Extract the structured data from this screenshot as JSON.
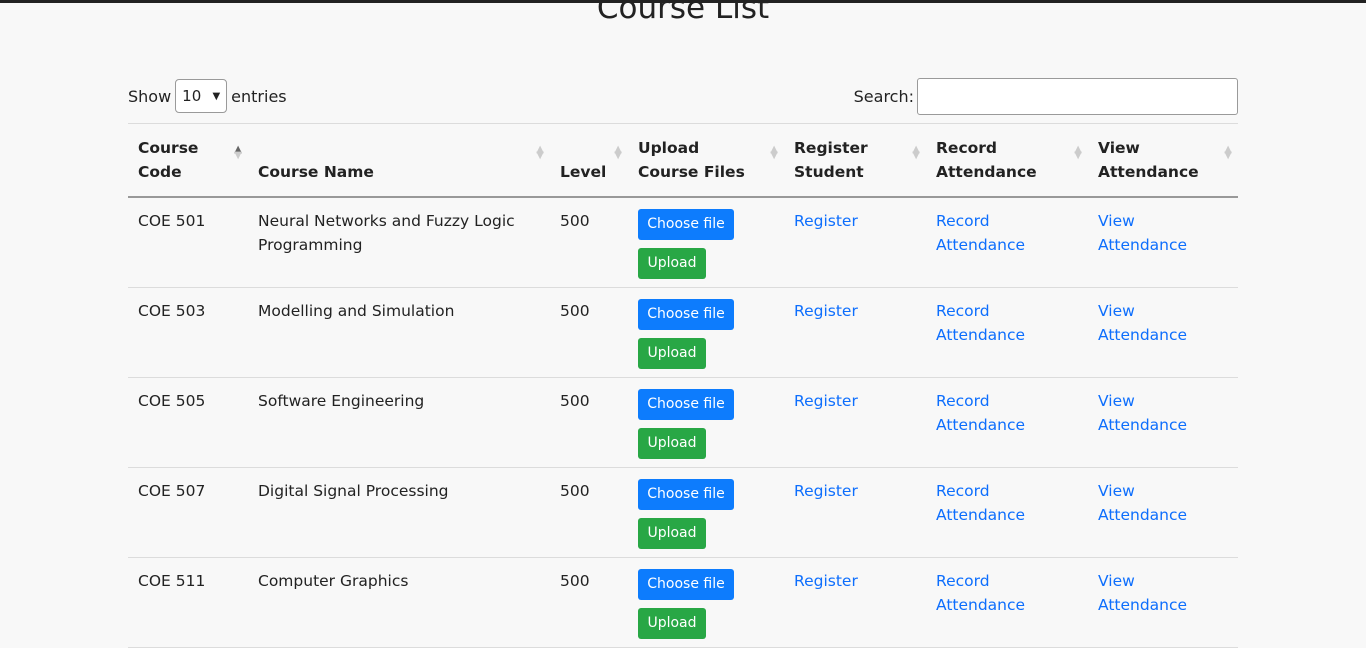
{
  "page": {
    "title": "Course List"
  },
  "controls": {
    "show_label": "Show",
    "entries_value": "10",
    "entries_label": "entries",
    "search_label": "Search:",
    "search_value": ""
  },
  "table": {
    "headers": [
      {
        "line1": "Course",
        "line2": "Code"
      },
      {
        "line1": "",
        "line2": "Course Name"
      },
      {
        "line1": "",
        "line2": "Level"
      },
      {
        "line1": "Upload",
        "line2": "Course Files"
      },
      {
        "line1": "Register",
        "line2": "Student"
      },
      {
        "line1": "Record",
        "line2": "Attendance"
      },
      {
        "line1": "View",
        "line2": "Attendance"
      }
    ],
    "sorted_column": "Course Code",
    "sort_direction": "ascending",
    "rows": [
      {
        "code": "COE 501",
        "name": "Neural Networks and Fuzzy Logic Programming",
        "level": "500",
        "choose_label": "Choose file",
        "upload_label": "Upload",
        "register_label": "Register",
        "record_line1": "Record",
        "record_line2": "Attendance",
        "view_line1": "View",
        "view_line2": "Attendance"
      },
      {
        "code": "COE 503",
        "name": "Modelling and Simulation",
        "level": "500",
        "choose_label": "Choose file",
        "upload_label": "Upload",
        "register_label": "Register",
        "record_line1": "Record",
        "record_line2": "Attendance",
        "view_line1": "View",
        "view_line2": "Attendance"
      },
      {
        "code": "COE 505",
        "name": "Software Engineering",
        "level": "500",
        "choose_label": "Choose file",
        "upload_label": "Upload",
        "register_label": "Register",
        "record_line1": "Record",
        "record_line2": "Attendance",
        "view_line1": "View",
        "view_line2": "Attendance"
      },
      {
        "code": "COE 507",
        "name": "Digital Signal Processing",
        "level": "500",
        "choose_label": "Choose file",
        "upload_label": "Upload",
        "register_label": "Register",
        "record_line1": "Record",
        "record_line2": "Attendance",
        "view_line1": "View",
        "view_line2": "Attendance"
      },
      {
        "code": "COE 511",
        "name": "Computer Graphics",
        "level": "500",
        "choose_label": "Choose file",
        "upload_label": "Upload",
        "register_label": "Register",
        "record_line1": "Record",
        "record_line2": "Attendance",
        "view_line1": "View",
        "view_line2": "Attendance"
      }
    ]
  },
  "colors": {
    "link": "#0d6efd",
    "choose_button": "#0d7cfd",
    "upload_button": "#28a745"
  }
}
